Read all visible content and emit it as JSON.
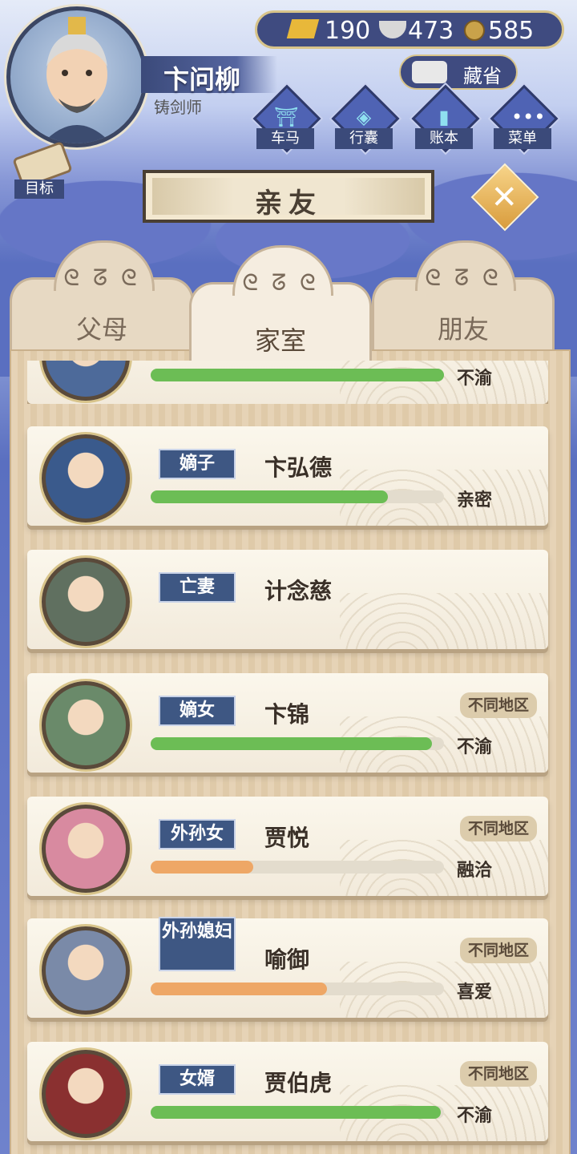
{
  "player": {
    "name": "卞问柳",
    "occupation": "铸剑师"
  },
  "currency": {
    "gold": "190",
    "silver": "473",
    "coin": "585"
  },
  "treasure_label": "藏省",
  "nav": [
    {
      "label": "车马",
      "icon": "carriage-icon"
    },
    {
      "label": "行囊",
      "icon": "bag-icon"
    },
    {
      "label": "账本",
      "icon": "ledger-icon"
    },
    {
      "label": "菜单",
      "icon": "menu-icon"
    }
  ],
  "goal_label": "目标",
  "banner_title": "亲友",
  "tabs": [
    {
      "label": "父母",
      "active": false
    },
    {
      "label": "家室",
      "active": true
    },
    {
      "label": "朋友",
      "active": false
    }
  ],
  "cards": [
    {
      "relation": "",
      "name": "",
      "mood": "不渝",
      "relationship_level": 1.0,
      "bar_color": "#6cbd55",
      "region": ""
    },
    {
      "relation": "嫡子",
      "name": "卞弘德",
      "mood": "亲密",
      "relationship_level": 0.81,
      "bar_color": "#6cbd55",
      "region": ""
    },
    {
      "relation": "亡妻",
      "name": "计念慈",
      "mood": "",
      "relationship_level": null,
      "bar_color": "",
      "region": ""
    },
    {
      "relation": "嫡女",
      "name": "卞锦",
      "mood": "不渝",
      "relationship_level": 0.96,
      "bar_color": "#6cbd55",
      "region": "不同地区"
    },
    {
      "relation": "外孙女",
      "name": "贾悦",
      "mood": "融洽",
      "relationship_level": 0.35,
      "bar_color": "#eea766",
      "region": "不同地区"
    },
    {
      "relation": "外孙媳妇",
      "name": "喻御",
      "mood": "喜爱",
      "relationship_level": 0.6,
      "bar_color": "#eea766",
      "region": "不同地区"
    },
    {
      "relation": "女婿",
      "name": "贾伯虎",
      "mood": "不渝",
      "relationship_level": 0.99,
      "bar_color": "#6cbd55",
      "region": "不同地区"
    }
  ],
  "colors": {
    "panel": "#e6d3b6",
    "badge": "#3e5783",
    "good_bar": "#6cbd55",
    "mid_bar": "#eea766"
  }
}
